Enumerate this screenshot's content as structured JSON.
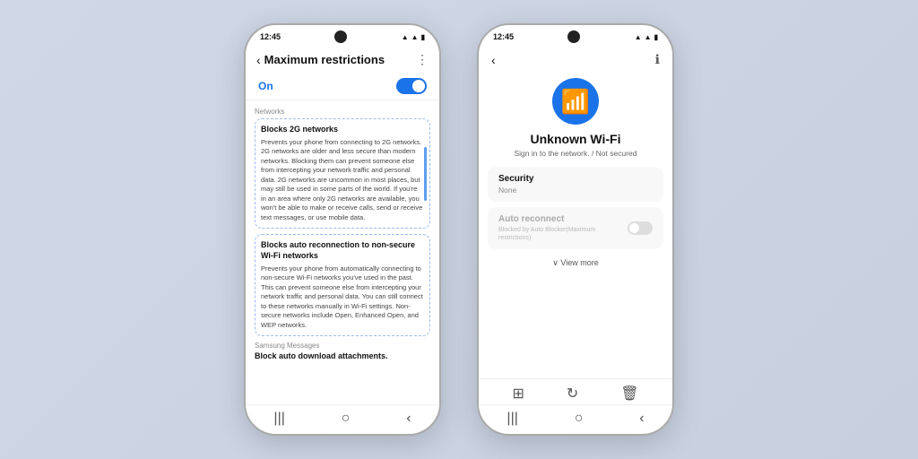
{
  "scene": {
    "background": "#c8d0e0"
  },
  "left_phone": {
    "status_time": "12:45",
    "header": {
      "title": "Maximum restrictions",
      "back_label": "‹",
      "more_label": "⋮"
    },
    "toggle": {
      "label": "On",
      "state": "on"
    },
    "networks_section_label": "Networks",
    "restriction1": {
      "title": "Blocks 2G networks",
      "text": "Prevents your phone from connecting to 2G networks. 2G networks are older and less secure than modern networks. Blocking them can prevent someone else from intercepting your network traffic and personal data. 2G networks are uncommon in most places, but may still be used in some parts of the world. If you're in an area where only 2G networks are available, you won't be able to make or receive calls, send or receive text messages, or use mobile data."
    },
    "restriction2": {
      "title": "Blocks auto reconnection to non-secure Wi-Fi networks",
      "text": "Prevents your phone from automatically connecting to non-secure Wi-Fi networks you've used in the past. This can prevent someone else from intercepting your network traffic and personal data. You can still connect to these networks manually in Wi-Fi settings. Non-secure networks include Open, Enhanced Open, and WEP networks."
    },
    "samsung_section_label": "Samsung Messages",
    "samsung_item": "Block auto download attachments."
  },
  "right_phone": {
    "status_time": "12:45",
    "header": {
      "back_label": "‹",
      "info_label": "ℹ"
    },
    "wifi_icon": "wifi",
    "network_name": "Unknown Wi-Fi",
    "network_sub": "Sign in to the network. / Not secured",
    "security_section": {
      "title": "Security",
      "value": "None"
    },
    "auto_reconnect_section": {
      "title": "Auto reconnect",
      "sub": "Blocked by Auto Blocker(Maximum restrictions)"
    },
    "view_more_label": "∨ View more",
    "bottom_actions": {
      "icon1": "⊞",
      "icon2": "↻",
      "icon3": "🗑"
    },
    "nav": {
      "icon1": "|||",
      "icon2": "○",
      "icon3": "‹"
    }
  }
}
